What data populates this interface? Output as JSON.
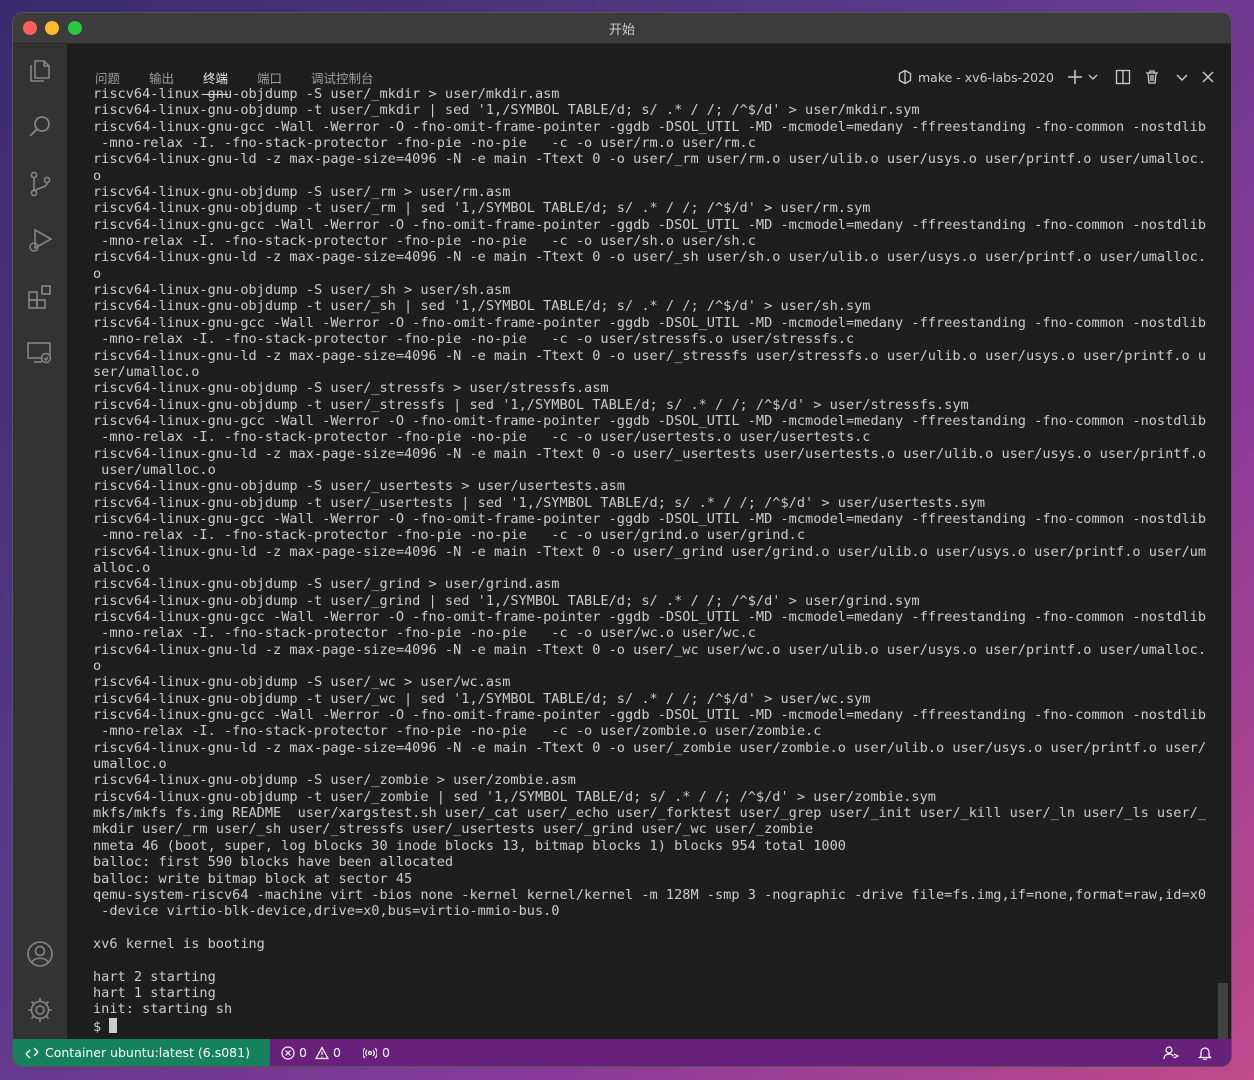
{
  "window": {
    "title": "开始"
  },
  "panel": {
    "tabs": [
      "问题",
      "输出",
      "终端",
      "端口",
      "调试控制台"
    ],
    "active_tab": "终端",
    "task_label": "make - xv6-labs-2020"
  },
  "terminal": {
    "lines": [
      "riscv64-linux-gnu-objdump -S user/_mkdir > user/mkdir.asm",
      "riscv64-linux-gnu-objdump -t user/_mkdir | sed '1,/SYMBOL TABLE/d; s/ .* / /; /^$/d' > user/mkdir.sym",
      "riscv64-linux-gnu-gcc -Wall -Werror -O -fno-omit-frame-pointer -ggdb -DSOL_UTIL -MD -mcmodel=medany -ffreestanding -fno-common -nostdlib",
      " -mno-relax -I. -fno-stack-protector -fno-pie -no-pie   -c -o user/rm.o user/rm.c",
      "riscv64-linux-gnu-ld -z max-page-size=4096 -N -e main -Ttext 0 -o user/_rm user/rm.o user/ulib.o user/usys.o user/printf.o user/umalloc.",
      "o",
      "riscv64-linux-gnu-objdump -S user/_rm > user/rm.asm",
      "riscv64-linux-gnu-objdump -t user/_rm | sed '1,/SYMBOL TABLE/d; s/ .* / /; /^$/d' > user/rm.sym",
      "riscv64-linux-gnu-gcc -Wall -Werror -O -fno-omit-frame-pointer -ggdb -DSOL_UTIL -MD -mcmodel=medany -ffreestanding -fno-common -nostdlib",
      " -mno-relax -I. -fno-stack-protector -fno-pie -no-pie   -c -o user/sh.o user/sh.c",
      "riscv64-linux-gnu-ld -z max-page-size=4096 -N -e main -Ttext 0 -o user/_sh user/sh.o user/ulib.o user/usys.o user/printf.o user/umalloc.",
      "o",
      "riscv64-linux-gnu-objdump -S user/_sh > user/sh.asm",
      "riscv64-linux-gnu-objdump -t user/_sh | sed '1,/SYMBOL TABLE/d; s/ .* / /; /^$/d' > user/sh.sym",
      "riscv64-linux-gnu-gcc -Wall -Werror -O -fno-omit-frame-pointer -ggdb -DSOL_UTIL -MD -mcmodel=medany -ffreestanding -fno-common -nostdlib",
      " -mno-relax -I. -fno-stack-protector -fno-pie -no-pie   -c -o user/stressfs.o user/stressfs.c",
      "riscv64-linux-gnu-ld -z max-page-size=4096 -N -e main -Ttext 0 -o user/_stressfs user/stressfs.o user/ulib.o user/usys.o user/printf.o u",
      "ser/umalloc.o",
      "riscv64-linux-gnu-objdump -S user/_stressfs > user/stressfs.asm",
      "riscv64-linux-gnu-objdump -t user/_stressfs | sed '1,/SYMBOL TABLE/d; s/ .* / /; /^$/d' > user/stressfs.sym",
      "riscv64-linux-gnu-gcc -Wall -Werror -O -fno-omit-frame-pointer -ggdb -DSOL_UTIL -MD -mcmodel=medany -ffreestanding -fno-common -nostdlib",
      " -mno-relax -I. -fno-stack-protector -fno-pie -no-pie   -c -o user/usertests.o user/usertests.c",
      "riscv64-linux-gnu-ld -z max-page-size=4096 -N -e main -Ttext 0 -o user/_usertests user/usertests.o user/ulib.o user/usys.o user/printf.o",
      " user/umalloc.o",
      "riscv64-linux-gnu-objdump -S user/_usertests > user/usertests.asm",
      "riscv64-linux-gnu-objdump -t user/_usertests | sed '1,/SYMBOL TABLE/d; s/ .* / /; /^$/d' > user/usertests.sym",
      "riscv64-linux-gnu-gcc -Wall -Werror -O -fno-omit-frame-pointer -ggdb -DSOL_UTIL -MD -mcmodel=medany -ffreestanding -fno-common -nostdlib",
      " -mno-relax -I. -fno-stack-protector -fno-pie -no-pie   -c -o user/grind.o user/grind.c",
      "riscv64-linux-gnu-ld -z max-page-size=4096 -N -e main -Ttext 0 -o user/_grind user/grind.o user/ulib.o user/usys.o user/printf.o user/um",
      "alloc.o",
      "riscv64-linux-gnu-objdump -S user/_grind > user/grind.asm",
      "riscv64-linux-gnu-objdump -t user/_grind | sed '1,/SYMBOL TABLE/d; s/ .* / /; /^$/d' > user/grind.sym",
      "riscv64-linux-gnu-gcc -Wall -Werror -O -fno-omit-frame-pointer -ggdb -DSOL_UTIL -MD -mcmodel=medany -ffreestanding -fno-common -nostdlib",
      " -mno-relax -I. -fno-stack-protector -fno-pie -no-pie   -c -o user/wc.o user/wc.c",
      "riscv64-linux-gnu-ld -z max-page-size=4096 -N -e main -Ttext 0 -o user/_wc user/wc.o user/ulib.o user/usys.o user/printf.o user/umalloc.",
      "o",
      "riscv64-linux-gnu-objdump -S user/_wc > user/wc.asm",
      "riscv64-linux-gnu-objdump -t user/_wc | sed '1,/SYMBOL TABLE/d; s/ .* / /; /^$/d' > user/wc.sym",
      "riscv64-linux-gnu-gcc -Wall -Werror -O -fno-omit-frame-pointer -ggdb -DSOL_UTIL -MD -mcmodel=medany -ffreestanding -fno-common -nostdlib",
      " -mno-relax -I. -fno-stack-protector -fno-pie -no-pie   -c -o user/zombie.o user/zombie.c",
      "riscv64-linux-gnu-ld -z max-page-size=4096 -N -e main -Ttext 0 -o user/_zombie user/zombie.o user/ulib.o user/usys.o user/printf.o user/",
      "umalloc.o",
      "riscv64-linux-gnu-objdump -S user/_zombie > user/zombie.asm",
      "riscv64-linux-gnu-objdump -t user/_zombie | sed '1,/SYMBOL TABLE/d; s/ .* / /; /^$/d' > user/zombie.sym",
      "mkfs/mkfs fs.img README  user/xargstest.sh user/_cat user/_echo user/_forktest user/_grep user/_init user/_kill user/_ln user/_ls user/_",
      "mkdir user/_rm user/_sh user/_stressfs user/_usertests user/_grind user/_wc user/_zombie",
      "nmeta 46 (boot, super, log blocks 30 inode blocks 13, bitmap blocks 1) blocks 954 total 1000",
      "balloc: first 590 blocks have been allocated",
      "balloc: write bitmap block at sector 45",
      "qemu-system-riscv64 -machine virt -bios none -kernel kernel/kernel -m 128M -smp 3 -nographic -drive file=fs.img,if=none,format=raw,id=x0",
      " -device virtio-blk-device,drive=x0,bus=virtio-mmio-bus.0",
      "",
      "xv6 kernel is booting",
      "",
      "hart 2 starting",
      "hart 1 starting",
      "init: starting sh"
    ],
    "prompt": "$ "
  },
  "statusbar": {
    "remote_label": "Container ubuntu:latest (6.s081)",
    "errors": "0",
    "warnings": "0",
    "ports": "0"
  },
  "colors": {
    "statusbar_bg": "#68217a",
    "remote_bg": "#16825d",
    "terminal_bg": "#1e1e1e",
    "activitybar_bg": "#333333"
  },
  "icons": {
    "activitybar": [
      "files-icon",
      "search-icon",
      "source-control-icon",
      "run-debug-icon",
      "extensions-icon",
      "remote-explorer-icon",
      "account-icon",
      "settings-gear-icon"
    ]
  }
}
